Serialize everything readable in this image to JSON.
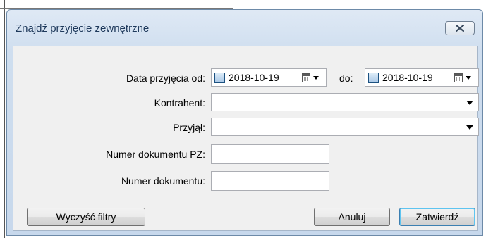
{
  "dialog": {
    "title": "Znajdź przyjęcie zewnętrzne",
    "close_icon": "close-icon"
  },
  "form": {
    "date_from_label": "Data przyjęcia od:",
    "date_from_value": "2018-10-19",
    "date_to_label": "do:",
    "date_to_value": "2018-10-19",
    "contractor_label": "Kontrahent:",
    "contractor_value": "",
    "received_by_label": "Przyjął:",
    "received_by_value": "",
    "pz_number_label": "Numer dokumentu PZ:",
    "pz_number_value": "",
    "doc_number_label": "Numer dokumentu:",
    "doc_number_value": ""
  },
  "buttons": {
    "clear_filters": "Wyczyść filtry",
    "cancel": "Anuluj",
    "confirm": "Zatwierdź"
  }
}
